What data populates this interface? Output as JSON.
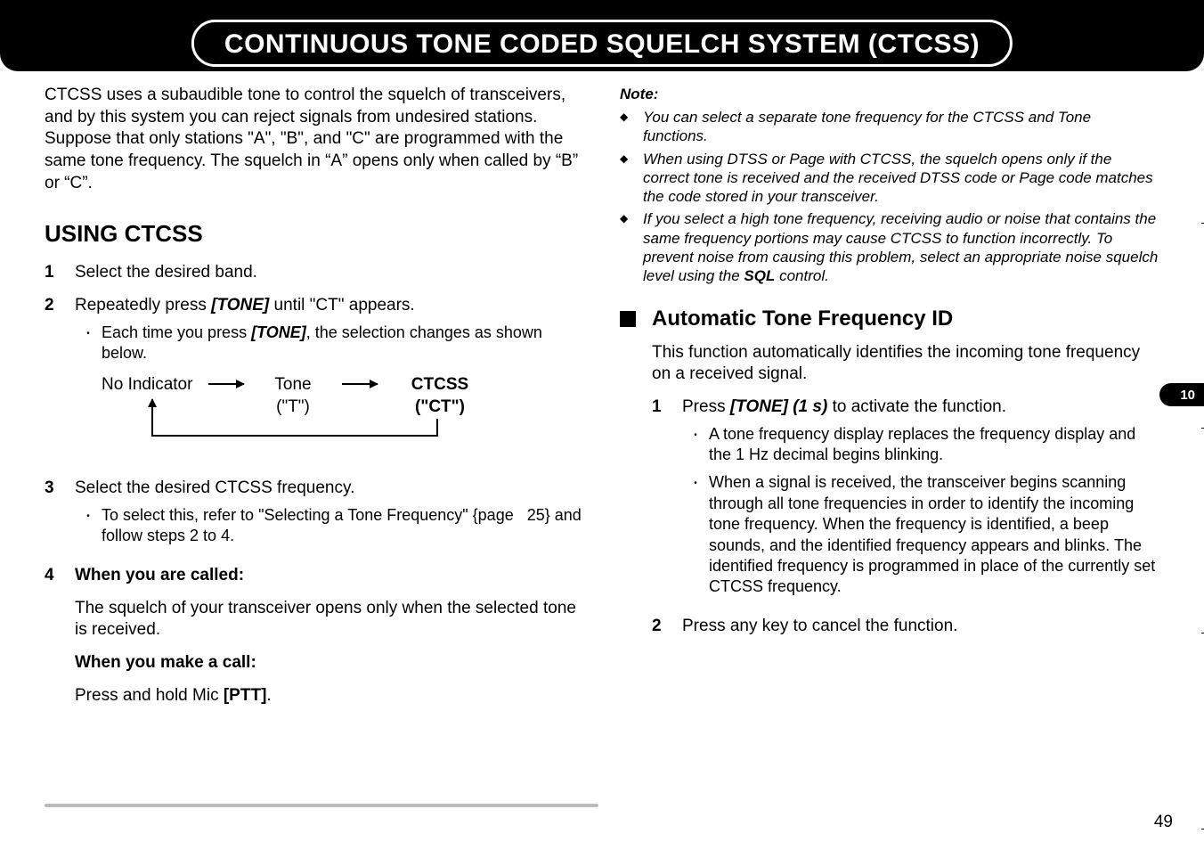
{
  "header": {
    "title": "CONTINUOUS TONE CODED SQUELCH SYSTEM (CTCSS)"
  },
  "left": {
    "intro": "CTCSS uses a subaudible tone to control the squelch of transceivers, and by this system you can reject signals from undesired stations.  Suppose that only stations \"A\", \"B\", and \"C\" are programmed with the same tone frequency.  The squelch in “A” opens only when called by “B” or “C”.",
    "section_title": "USING CTCSS",
    "step1": "Select the desired band.",
    "step2_a": "Repeatedly press ",
    "step2_key": "[TONE]",
    "step2_b": " until \"CT\" appears.",
    "step2_sub_a": "Each time you press ",
    "step2_sub_key": "[TONE]",
    "step2_sub_b": ", the selection changes as shown below.",
    "diag": {
      "no_ind": "No Indicator",
      "tone": "Tone",
      "tone_sub": "(\"T\")",
      "ctcss": "CTCSS",
      "ctcss_sub": "(\"CT\")"
    },
    "step3": "Select the desired CTCSS frequency.",
    "step3_sub": "To select this, refer to \"Selecting a Tone Frequency\" {page   25} and follow steps 2 to 4.",
    "step4_h": "When you are called:",
    "step4_body": "The squelch of your transceiver opens only when the selected tone is received.",
    "step4_call_h": "When you make a call:",
    "step4_call_a": "Press and hold Mic ",
    "step4_call_key": "[PTT]",
    "step4_call_b": "."
  },
  "right": {
    "note_h": "Note:",
    "note1": "You can select a separate tone frequency for the CTCSS and Tone functions.",
    "note2": "When using DTSS or Page with CTCSS, the squelch opens only if the correct tone is received and the received DTSS code or Page code matches the code stored in your transceiver.",
    "note3_a": "If you select a high tone frequency, receiving audio or noise that contains the same frequency portions may cause CTCSS to function incorrectly.  To prevent noise from causing this problem, select an appropriate noise squelch level using the ",
    "note3_key": "SQL",
    "note3_b": " control.",
    "sub_h": "Automatic Tone Frequency ID",
    "sub_intro": "This function automatically identifies the incoming tone frequency on a received signal.",
    "r_step1_a": "Press ",
    "r_step1_key": "[TONE] (1 s)",
    "r_step1_b": " to activate the function.",
    "r_step1_sub1": "A tone frequency display replaces the frequency display and the 1 Hz decimal begins blinking.",
    "r_step1_sub2": "When a signal is received, the transceiver begins scanning through all tone frequencies in order to identify the incoming tone frequency.  When the frequency is identified, a beep sounds, and the identified frequency appears and blinks.  The identified frequency is programmed in place of the currently set CTCSS frequency.",
    "r_step2": "Press any key to cancel the function."
  },
  "tab": "10",
  "page_num": "49"
}
